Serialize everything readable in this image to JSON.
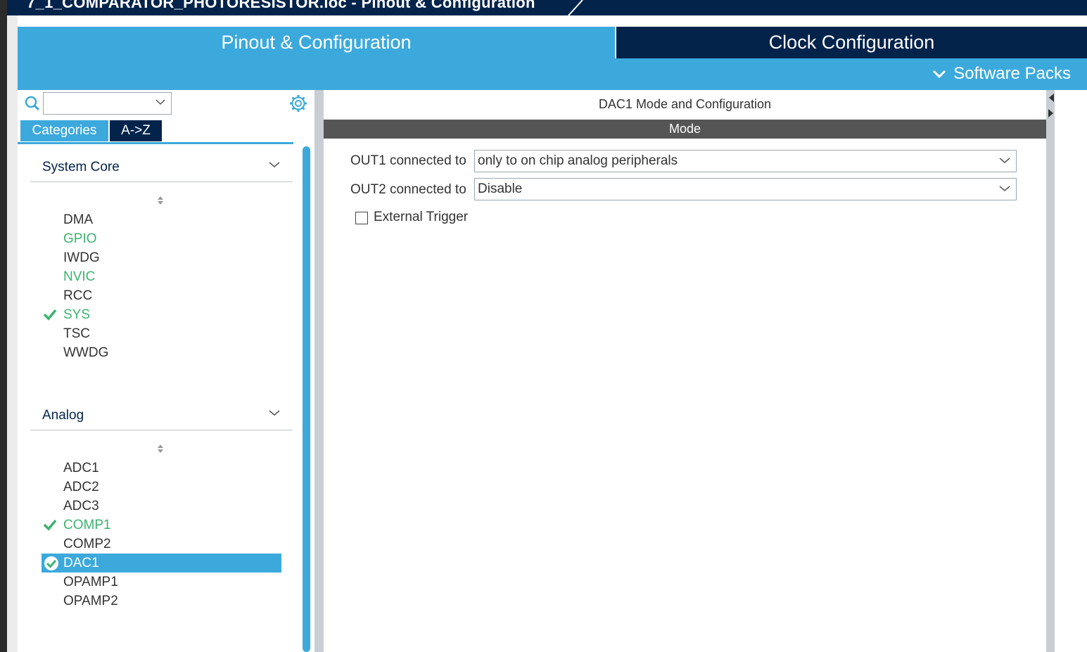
{
  "window": {
    "title": "7_1_COMPARATOR_PHOTORESISTOR.ioc - Pinout & Configuration"
  },
  "main_tabs": {
    "pinout": "Pinout & Configuration",
    "clock": "Clock Configuration"
  },
  "software_packs": "Software Packs",
  "left_panel": {
    "search": {
      "value": ""
    },
    "tabs": {
      "categories": "Categories",
      "az": "A->Z"
    },
    "groups": [
      {
        "title": "System Core",
        "items": [
          {
            "label": "DMA",
            "status": "none"
          },
          {
            "label": "GPIO",
            "status": "configured"
          },
          {
            "label": "IWDG",
            "status": "none"
          },
          {
            "label": "NVIC",
            "status": "configured"
          },
          {
            "label": "RCC",
            "status": "none"
          },
          {
            "label": "SYS",
            "status": "checked"
          },
          {
            "label": "TSC",
            "status": "none"
          },
          {
            "label": "WWDG",
            "status": "none"
          }
        ]
      },
      {
        "title": "Analog",
        "items": [
          {
            "label": "ADC1",
            "status": "none"
          },
          {
            "label": "ADC2",
            "status": "none"
          },
          {
            "label": "ADC3",
            "status": "none"
          },
          {
            "label": "COMP1",
            "status": "checked"
          },
          {
            "label": "COMP2",
            "status": "none"
          },
          {
            "label": "DAC1",
            "status": "selected-checked"
          },
          {
            "label": "OPAMP1",
            "status": "none"
          },
          {
            "label": "OPAMP2",
            "status": "none"
          }
        ]
      }
    ]
  },
  "right_panel": {
    "title": "DAC1 Mode and Configuration",
    "mode_header": "Mode",
    "fields": [
      {
        "label": "OUT1 connected to",
        "value": "only to on chip analog peripherals"
      },
      {
        "label": "OUT2 connected to",
        "value": "Disable"
      }
    ],
    "external_trigger": {
      "label": "External Trigger",
      "checked": false
    }
  },
  "colors": {
    "accent": "#3ca9dc",
    "dark": "#03234b",
    "configured": "#3cb371",
    "mode_bar": "#555555"
  }
}
